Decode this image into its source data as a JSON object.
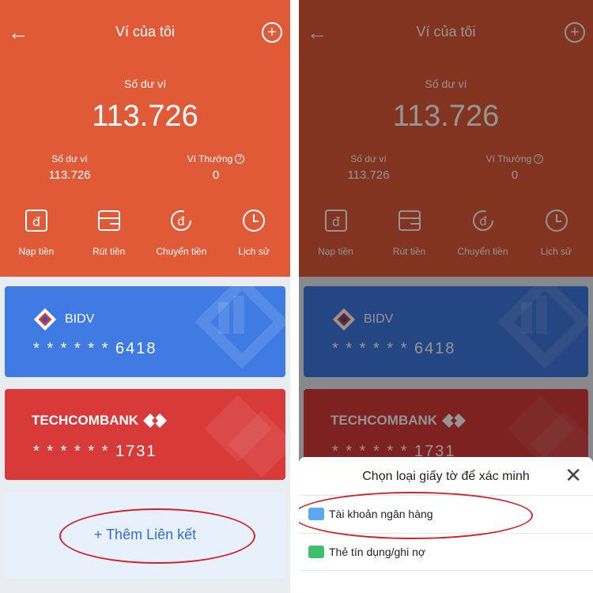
{
  "header": {
    "title": "Ví của tôi",
    "back_icon": "arrow-left-icon",
    "add_icon": "plus-circle-icon",
    "balance_label": "Số dư ví",
    "balance_value": "113.726",
    "sub_balances": [
      {
        "label": "Số dư ví",
        "value": "113.726"
      },
      {
        "label": "Ví Thưởng",
        "value": "0"
      }
    ]
  },
  "actions": [
    {
      "label": "Nạp tiền",
      "icon": "deposit-icon"
    },
    {
      "label": "Rút tiền",
      "icon": "withdraw-icon"
    },
    {
      "label": "Chuyển tiền",
      "icon": "transfer-icon"
    },
    {
      "label": "Lịch sử",
      "icon": "history-icon"
    }
  ],
  "cards": [
    {
      "bank": "BIDV",
      "number": "* * * * * *  6418",
      "color": "#3f7be3"
    },
    {
      "bank": "TECHCOMBANK",
      "number": "* * * * * *  1731",
      "color": "#d83a3a"
    }
  ],
  "add_link": {
    "label": "+ Thêm Liên kết"
  },
  "sheet": {
    "title": "Chọn loại giấy tờ để xác minh",
    "options": [
      {
        "label": "Tài khoản ngân hàng",
        "icon": "bank-account-icon"
      },
      {
        "label": "Thẻ tín dụng/ghi nợ",
        "icon": "credit-card-icon"
      }
    ]
  },
  "colors": {
    "header": "#e05a38",
    "accent": "#2f6fd6",
    "highlight": "#d5222a"
  }
}
